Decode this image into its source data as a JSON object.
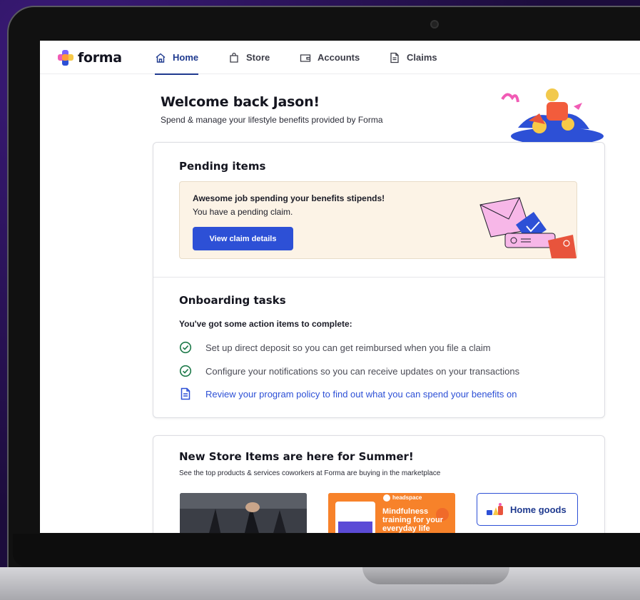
{
  "brand": {
    "name": "forma",
    "colors": [
      "#f15bb5",
      "#7b61ff",
      "#f7c948",
      "#2d50d6"
    ]
  },
  "nav": [
    {
      "label": "Home",
      "icon": "home-icon",
      "active": true
    },
    {
      "label": "Store",
      "icon": "bag-icon",
      "active": false
    },
    {
      "label": "Accounts",
      "icon": "wallet-icon",
      "active": false
    },
    {
      "label": "Claims",
      "icon": "document-icon",
      "active": false
    }
  ],
  "welcome": {
    "title": "Welcome back Jason!",
    "subtitle": "Spend & manage your lifestyle benefits provided by Forma"
  },
  "pending": {
    "title": "Pending items",
    "line1": "Awesome job spending your benefits stipends!",
    "line2": "You have a pending claim.",
    "button": "View claim details"
  },
  "onboarding": {
    "title": "Onboarding tasks",
    "subtitle": "You've got some action items to complete:",
    "tasks": [
      {
        "label": "Set up direct deposit so you can get reimbursed when you file a claim",
        "icon": "check-circle-icon",
        "done": true
      },
      {
        "label": "Configure your notifications so you can receive updates on your transactions",
        "icon": "check-circle-icon",
        "done": true
      },
      {
        "label": "Review your program policy to find out what you can spend your benefits on",
        "icon": "document-icon",
        "done": false
      }
    ]
  },
  "store": {
    "title": "New Store Items are here for Summer!",
    "subtitle": "See the top products & services coworkers at Forma are buying in the marketplace",
    "tiles": [
      {
        "type": "photo"
      },
      {
        "brand": "headspace",
        "headline": "Mindfulness training for your everyday life"
      },
      {
        "label": "Home goods"
      }
    ]
  },
  "colors": {
    "primary": "#2d50d6",
    "nav_active": "#1f3a8f",
    "pending_bg": "#fcf3e6",
    "success": "#1e7a4a"
  }
}
